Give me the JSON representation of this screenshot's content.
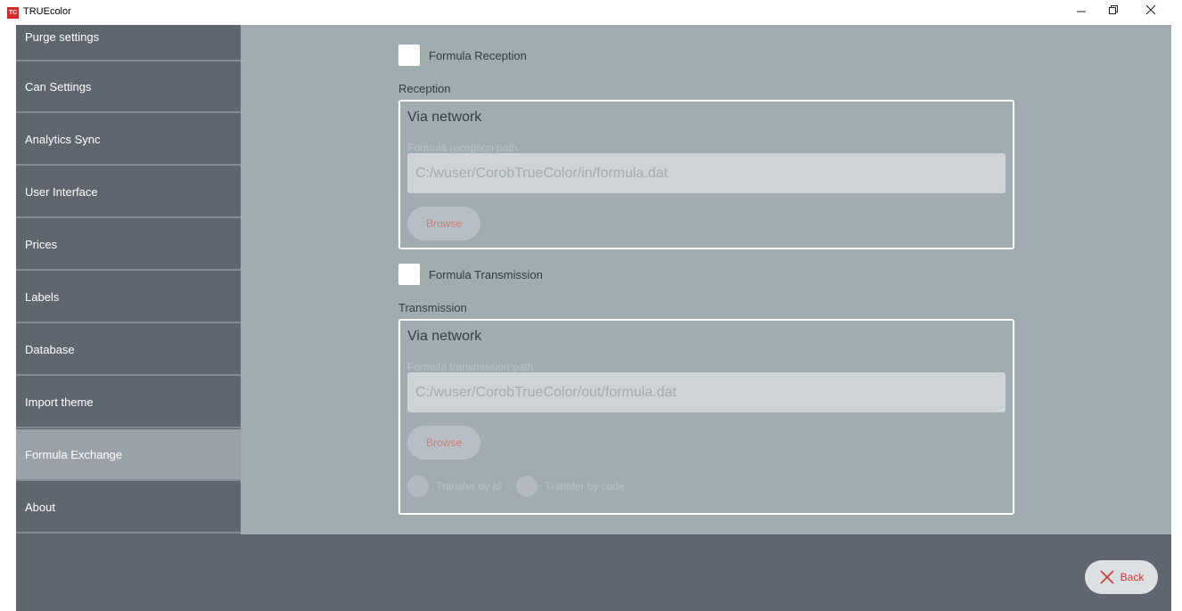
{
  "window": {
    "logo_text": "TC",
    "title": "TRUEcolor",
    "controls": {
      "minimize": "—",
      "restore": "❐",
      "close": "✕"
    }
  },
  "sidebar": {
    "items": [
      {
        "label": "Purge settings"
      },
      {
        "label": "Can Settings"
      },
      {
        "label": "Analytics Sync"
      },
      {
        "label": "User Interface"
      },
      {
        "label": "Prices"
      },
      {
        "label": "Labels"
      },
      {
        "label": "Database"
      },
      {
        "label": "Import theme"
      },
      {
        "label": "Formula Exchange",
        "selected": true
      },
      {
        "label": "About"
      }
    ]
  },
  "reception": {
    "checkbox_label": "Formula Reception",
    "checked": false,
    "section_label": "Reception",
    "group_title": "Via network",
    "path_label": "Formula reception path",
    "path_value": "C:/wuser/CorobTrueColor/in/formula.dat",
    "browse_label": "Browse"
  },
  "transmission": {
    "checkbox_label": "Formula Transmission",
    "checked": false,
    "section_label": "Transmission",
    "group_title": "Via network",
    "path_label": "Formula transmission path",
    "path_value": "C:/wuser/CorobTrueColor/out/formula.dat",
    "browse_label": "Browse",
    "radio_by_id_label": "Transfer by Id",
    "radio_by_code_label": "Transfer by code"
  },
  "footer": {
    "back_label": "Back",
    "back_icon": "close-x-icon"
  },
  "colors": {
    "sidebar_bg": "#5f6670",
    "sidebar_selected": "#9aa1a8",
    "content_bg": "#a1acb1",
    "accent_red": "#c93a37"
  }
}
